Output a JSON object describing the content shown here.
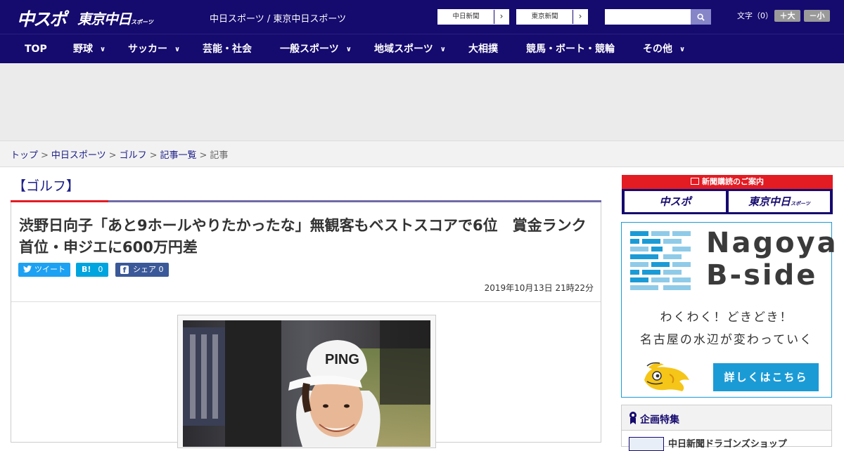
{
  "header": {
    "logo_primary": "中スポ",
    "logo_secondary": "東京中日",
    "logo_secondary_small": "スポーツ",
    "site_title": "中日スポーツ / 東京中日スポーツ",
    "ext_links": [
      {
        "label": "中日新聞"
      },
      {
        "label": "東京新聞"
      }
    ],
    "search": {
      "placeholder": "",
      "button_icon": "search-icon"
    },
    "font_size": {
      "label": "文字（0）",
      "increase": "＋大",
      "decrease": "－小"
    }
  },
  "nav": {
    "items": [
      {
        "label": "TOP",
        "dropdown": false
      },
      {
        "label": "野球",
        "dropdown": true
      },
      {
        "label": "サッカー",
        "dropdown": true
      },
      {
        "label": "芸能・社会",
        "dropdown": false
      },
      {
        "label": "一般スポーツ",
        "dropdown": true
      },
      {
        "label": "地域スポーツ",
        "dropdown": true
      },
      {
        "label": "大相撲",
        "dropdown": false
      },
      {
        "label": "競馬・ボート・競輪",
        "dropdown": false
      },
      {
        "label": "その他",
        "dropdown": true
      }
    ]
  },
  "breadcrumb": {
    "items": [
      "トップ",
      "中日スポーツ",
      "ゴルフ",
      "記事一覧"
    ],
    "current": "記事",
    "separator": ">"
  },
  "article": {
    "category": "【ゴルフ】",
    "headline": "渋野日向子「あと9ホールやりたかったな」無観客もベストスコアで6位　賞金ランク首位・申ジエに600万円差",
    "share": {
      "tweet": "ツイート",
      "hatena_icon": "B!",
      "hatena_count": "0",
      "facebook": "シェア",
      "facebook_count": "0"
    },
    "date": "2019年10月13日 21時22分",
    "photo_text": "PING"
  },
  "sidebar": {
    "subscribe": {
      "title": "新聞購読のご案内",
      "buttons": [
        "中スポ",
        "東京中日"
      ],
      "button_small": "スポーツ"
    },
    "bside": {
      "title_line1": "Nagoya",
      "title_line2": "B-side",
      "tagline1": "わくわく！どきどき！",
      "tagline2": "名古屋の水辺が変わっていく",
      "button": "詳しくはこちら"
    },
    "kikaku": {
      "title": "企画特集",
      "item": "中日新聞ドラゴンズショップ"
    }
  },
  "colors": {
    "brand_navy": "#150a6e",
    "accent_red": "#e31b23",
    "bside_blue": "#1b9bd6",
    "twitter": "#1da1f2",
    "hatena": "#00a4de",
    "facebook": "#3b5998"
  }
}
